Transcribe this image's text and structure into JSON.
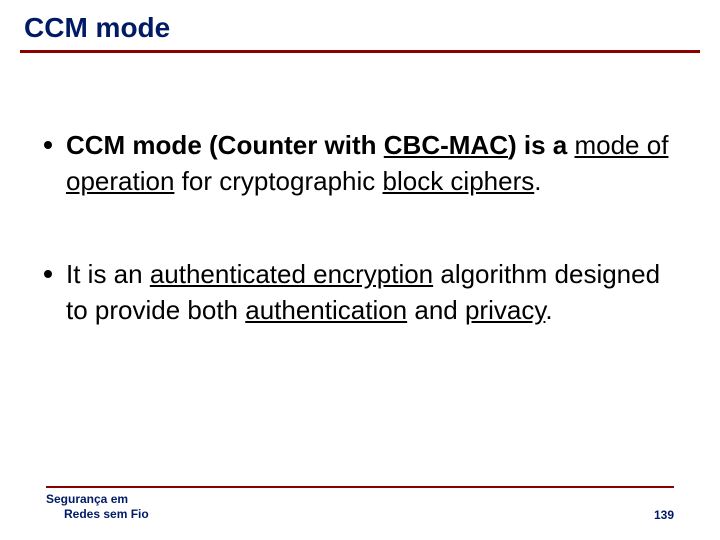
{
  "title": "CCM mode",
  "bullets": [
    {
      "runs": [
        {
          "t": "CCM mode",
          "b": true
        },
        {
          "t": " ",
          "b": true
        },
        {
          "t": "(Counter with ",
          "b": true
        },
        {
          "t": "CBC-MAC",
          "b": true,
          "u": true
        },
        {
          "t": ") is a ",
          "b": true
        },
        {
          "t": "mode of operation",
          "u": true
        },
        {
          "t": " for cryptographic "
        },
        {
          "t": "block ciphers",
          "u": true
        },
        {
          "t": "."
        }
      ]
    },
    {
      "runs": [
        {
          "t": "It is an "
        },
        {
          "t": "authenticated encryption",
          "u": true
        },
        {
          "t": " algorithm designed to provide both "
        },
        {
          "t": "authentication",
          "u": true
        },
        {
          "t": " and "
        },
        {
          "t": "privacy",
          "u": true
        },
        {
          "t": "."
        }
      ]
    }
  ],
  "footer": {
    "line1": "Segurança em",
    "line2": "Redes sem Fio",
    "page": "139"
  }
}
